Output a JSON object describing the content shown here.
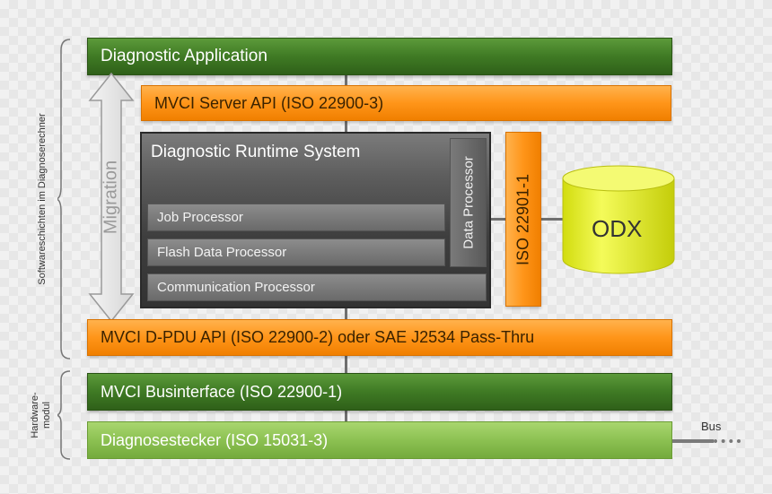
{
  "layers": {
    "diagnostic_application": "Diagnostic Application",
    "mvci_server_api": "MVCI Server API (ISO 22900-3)",
    "runtime": {
      "title": "Diagnostic Runtime System",
      "job_processor": "Job Processor",
      "flash_data_processor": "Flash Data Processor",
      "communication_processor": "Communication Processor",
      "data_processor": "Data Processor"
    },
    "iso_22901": "ISO 22901-1",
    "odx": "ODX",
    "migration": "Migration",
    "d_pdu_api": "MVCI D-PDU API (ISO 22900-2) oder SAE J2534 Pass-Thru",
    "businterface": "MVCI Businterface (ISO 22900-1)",
    "diagnosestecker": "Diagnosestecker (ISO 15031-3)",
    "bus": "Bus"
  },
  "side_labels": {
    "software": "Softwareschichten im Diagnoserechner",
    "hardware": "Hardware-\nmodul"
  },
  "colors": {
    "dark_green": "#3f7a24",
    "orange": "#ff9519",
    "light_green": "#8cc152",
    "runtime_gray": "#4a4a4a",
    "odx_yellow": "#e4ee1a"
  }
}
